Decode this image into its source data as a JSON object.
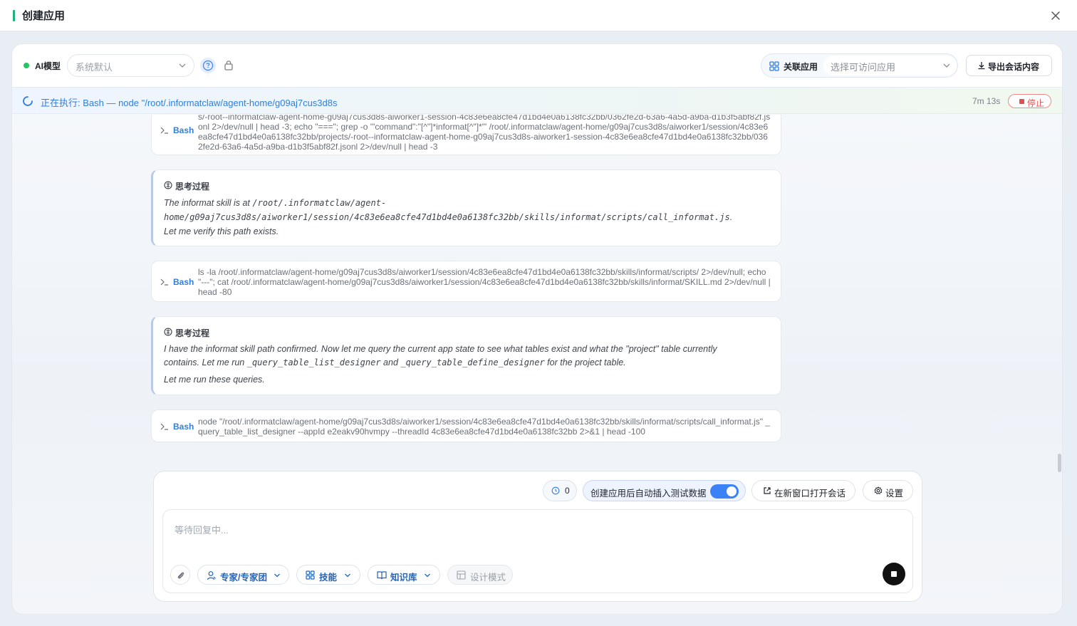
{
  "window": {
    "title": "创建应用",
    "accent_color": "#22b07d"
  },
  "toolbar": {
    "model_label": "AI模型",
    "model_placeholder": "系统默认",
    "link_app_label": "关联应用",
    "link_app_placeholder": "选择可访问应用",
    "export_label": "导出会话内容"
  },
  "status": {
    "text": "正在执行: Bash — node \"/root/.informatclaw/agent-home/g09aj7cus3d8s",
    "elapsed": "7m 13s",
    "stop_label": "停止"
  },
  "stream": {
    "bash_label": "Bash",
    "think_title": "思考过程",
    "items": [
      {
        "type": "bash",
        "command": "s/-root--informatclaw-agent-home-g09aj7cus3d8s-aiworker1-session-4c83e6ea8cfe47d1bd4e0a6138fc32bb/0362fe2d-63a6-4a5d-a9ba-d1b3f5abf82f.jsonl 2>/dev/null | head -3; echo \"===\"; grep -o '\"command\":\"[^\"]*informat[^\"]*\"' /root/.informatclaw/agent-home/g09aj7cus3d8s/aiworker1/session/4c83e6ea8cfe47d1bd4e0a6138fc32bb/projects/-root--informatclaw-agent-home-g09aj7cus3d8s-aiworker1-session-4c83e6ea8cfe47d1bd4e0a6138fc32bb/0362fe2d-63a6-4a5d-a9ba-d1b3f5abf82f.jsonl 2>/dev/null | head -3"
      },
      {
        "type": "think",
        "line1_pre": "The informat skill is at ",
        "line1_code": "/root/.informatclaw/agent-",
        "line2_code": "home/g09aj7cus3d8s/aiworker1/session/4c83e6ea8cfe47d1bd4e0a6138fc32bb/skills/informat/scripts/call_informat.js",
        "line2_post": ".",
        "line3": "Let me verify this path exists."
      },
      {
        "type": "bash",
        "command": "ls -la /root/.informatclaw/agent-home/g09aj7cus3d8s/aiworker1/session/4c83e6ea8cfe47d1bd4e0a6138fc32bb/skills/informat/scripts/ 2>/dev/null; echo \"---\"; cat /root/.informatclaw/agent-home/g09aj7cus3d8s/aiworker1/session/4c83e6ea8cfe47d1bd4e0a6138fc32bb/skills/informat/SKILL.md 2>/dev/null | head -80"
      },
      {
        "type": "think",
        "line1": "I have the informat skill path confirmed. Now let me query the current app state to see what tables exist and what the \"project\" table currently",
        "line2_pre": "contains. Let me run ",
        "line2_code1": "_query_table_list_designer",
        "line2_mid": " and ",
        "line2_code2": "_query_table_define_designer",
        "line2_post": " for the project table.",
        "line3": "Let me run these queries."
      },
      {
        "type": "bash",
        "command": "node \"/root/.informatclaw/agent-home/g09aj7cus3d8s/aiworker1/session/4c83e6ea8cfe47d1bd4e0a6138fc32bb/skills/informat/scripts/call_informat.js\" _query_table_list_designer --appId e2eakv90hvmpy --threadId 4c83e6ea8cfe47d1bd4e0a6138fc32bb 2>&1 | head -100"
      }
    ]
  },
  "composer": {
    "counter": "0",
    "auto_insert_label": "创建应用后自动插入测试数据",
    "auto_insert_on": true,
    "open_new_label": "在新窗口打开会话",
    "settings_label": "设置",
    "input_placeholder": "等待回复中...",
    "tools": {
      "expert": "专家/专家团",
      "skills": "技能",
      "knowledge": "知识库",
      "design_mode": "设计模式"
    }
  },
  "colors": {
    "primary": "#2f7de1",
    "toggle": "#3b82f6",
    "danger": "#e05252",
    "online": "#22c55e"
  }
}
